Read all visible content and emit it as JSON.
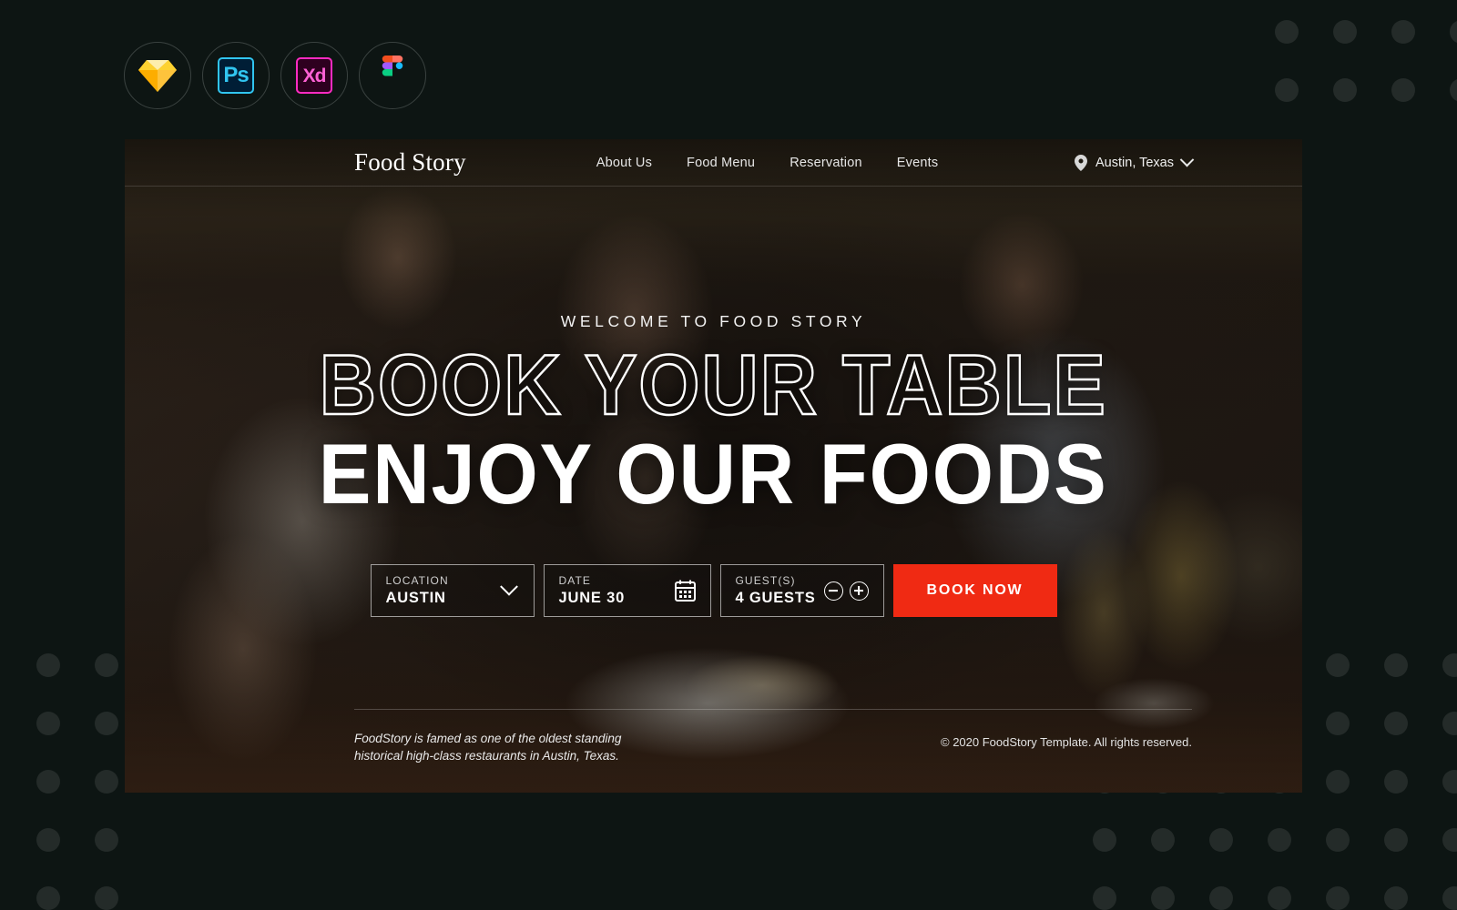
{
  "page": {
    "background_color": "#0d1513",
    "accent_color": "#f02a13"
  },
  "tool_badges": [
    {
      "name": "sketch",
      "label": "Sketch",
      "icon": "sketch-gem-icon",
      "color": "#f7b500"
    },
    {
      "name": "photoshop",
      "label": "Ps",
      "icon": "photoshop-icon",
      "color": "#31c5f0"
    },
    {
      "name": "adobe-xd",
      "label": "Xd",
      "icon": "adobe-xd-icon",
      "color": "#ff2bc2"
    },
    {
      "name": "figma",
      "label": "Figma",
      "icon": "figma-icon",
      "color": "#f24e1e"
    }
  ],
  "navbar": {
    "brand": "Food Story",
    "links": [
      {
        "label": "About Us"
      },
      {
        "label": "Food Menu"
      },
      {
        "label": "Reservation"
      },
      {
        "label": "Events"
      }
    ],
    "location": {
      "icon": "map-pin-icon",
      "value": "Austin, Texas",
      "chevron": "chevron-down-icon"
    }
  },
  "hero": {
    "eyebrow": "WELCOME TO FOOD STORY",
    "headline_outline": "BOOK YOUR TABLE",
    "headline_solid": "ENJOY OUR FOODS"
  },
  "booking": {
    "location": {
      "label": "LOCATION",
      "value": "AUSTIN",
      "icon": "chevron-down-icon"
    },
    "date": {
      "label": "DATE",
      "value": "JUNE 30",
      "icon": "calendar-icon"
    },
    "guests": {
      "label": "GUEST(S)",
      "value": "4 GUESTS",
      "decrement_icon": "minus-circle-icon",
      "increment_icon": "plus-circle-icon"
    },
    "cta_label": "BOOK NOW"
  },
  "hero_footer": {
    "tagline_line1": "FoodStory is famed as one of the oldest standing",
    "tagline_line2": "historical high-class restaurants in Austin, Texas.",
    "copyright": "© 2020 FoodStory Template. All rights reserved."
  }
}
